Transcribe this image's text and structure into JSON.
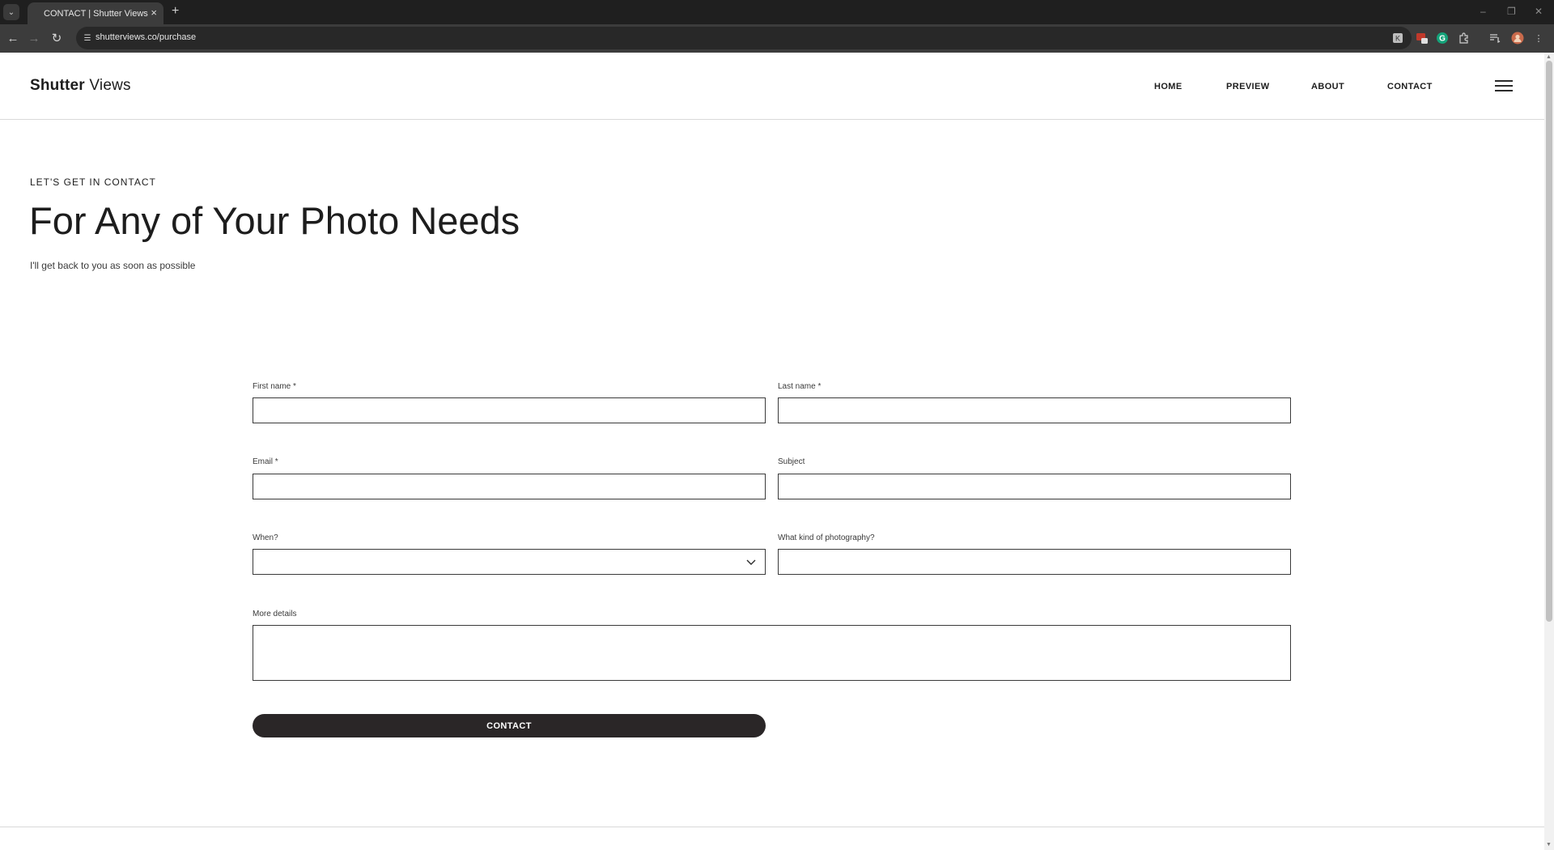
{
  "browser": {
    "tab_title": "CONTACT | Shutter Views",
    "url": "shutterviews.co/purchase",
    "window_controls": [
      "–",
      "❐",
      "✕"
    ]
  },
  "site": {
    "logo_bold": "Shutter",
    "logo_light": "Views",
    "nav": [
      "HOME",
      "PREVIEW",
      "ABOUT",
      "CONTACT"
    ]
  },
  "hero": {
    "eyebrow": "LET'S GET IN CONTACT",
    "headline": "For Any of Your Photo Needs",
    "subline": "I'll get back to you as soon as possible"
  },
  "form": {
    "first_name_label": "First name *",
    "last_name_label": "Last name *",
    "email_label": "Email *",
    "subject_label": "Subject",
    "when_label": "When?",
    "photography_label": "What kind of photography?",
    "details_label": "More details",
    "first_name_value": "",
    "last_name_value": "",
    "email_value": "",
    "subject_value": "",
    "when_value": "",
    "photography_value": "",
    "details_value": "",
    "submit_label": "CONTACT"
  },
  "icons": {
    "tab_search": "chevron-down-icon",
    "back": "arrow-left-icon",
    "forward": "arrow-right-icon",
    "reload": "reload-icon",
    "site_info": "tune-icon",
    "bookmark": "star-icon",
    "menu": "hamburger-icon",
    "select": "chevron-down-icon"
  }
}
